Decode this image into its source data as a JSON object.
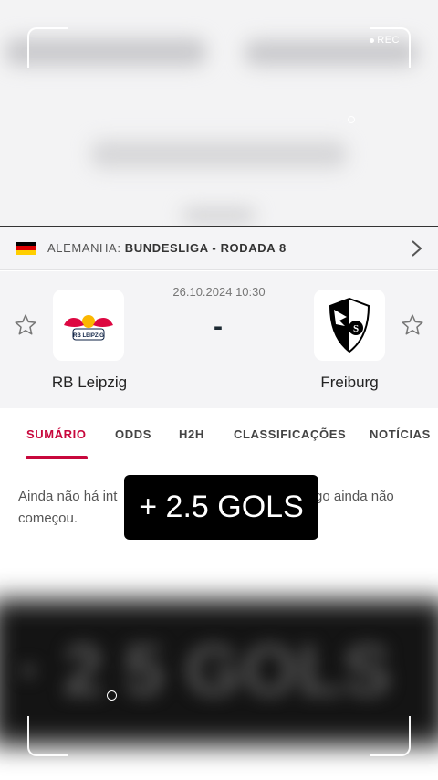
{
  "recorder": {
    "rec_label": "REC"
  },
  "league": {
    "country": "ALEMANHA:",
    "competition": "BUNDESLIGA - RODADA 8",
    "flag_colors": [
      "#000000",
      "#dd0000",
      "#ffce00"
    ]
  },
  "match": {
    "datetime": "26.10.2024 10:30",
    "score": "-",
    "home": {
      "name": "RB Leipzig",
      "logo_text": "RB LEIPZIG"
    },
    "away": {
      "name": "Freiburg",
      "logo_text": "S"
    }
  },
  "tabs": [
    "SUMÁRIO",
    "ODDS",
    "H2H",
    "CLASSIFICAÇÕES",
    "NOTÍCIAS"
  ],
  "summary": {
    "line1_left": "Ainda não há int",
    "line1_right": "go ainda não",
    "line2": "começou."
  },
  "overlay": {
    "caption": "+ 2.5 GOLS"
  },
  "colors": {
    "accent": "#c8073c",
    "panel": "#f4f4f6"
  }
}
